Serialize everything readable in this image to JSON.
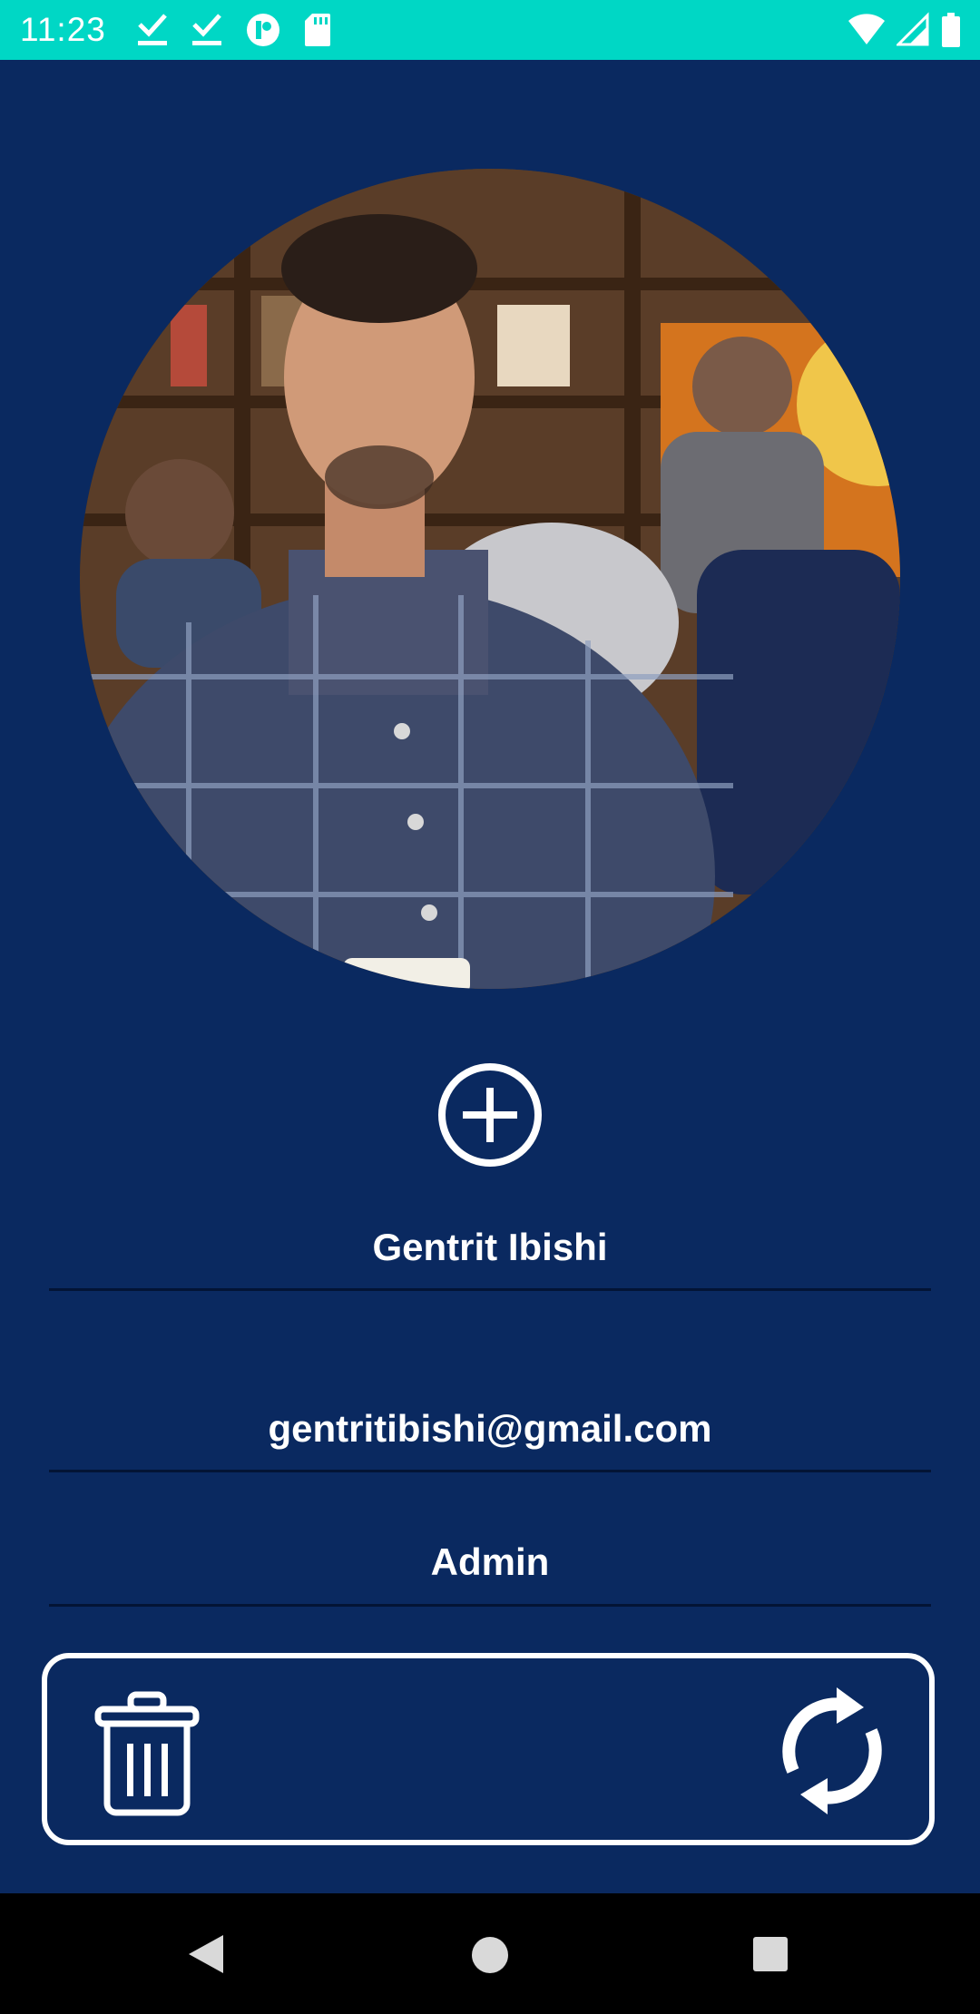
{
  "status_bar": {
    "time": "11:23",
    "notification_icons": [
      "checkmark-icon",
      "checkmark-icon",
      "p-badge-icon",
      "sd-card-icon"
    ],
    "system_icons": [
      "wifi-icon",
      "signal-icon",
      "battery-icon"
    ],
    "background_color": "#00d7c5"
  },
  "profile": {
    "avatar_description_icon": "profile-photo",
    "add_photo_icon": "plus-circle-icon",
    "name": "Gentrit Ibishi",
    "email": "gentritibishi@gmail.com",
    "role": "Admin"
  },
  "actions": {
    "delete_icon": "trash-icon",
    "refresh_icon": "refresh-icon"
  },
  "navigation": {
    "buttons": [
      "back-icon",
      "home-icon",
      "recents-icon"
    ]
  },
  "colors": {
    "background": "#0a2960",
    "accent": "#00d7c5",
    "text": "#ffffff"
  }
}
